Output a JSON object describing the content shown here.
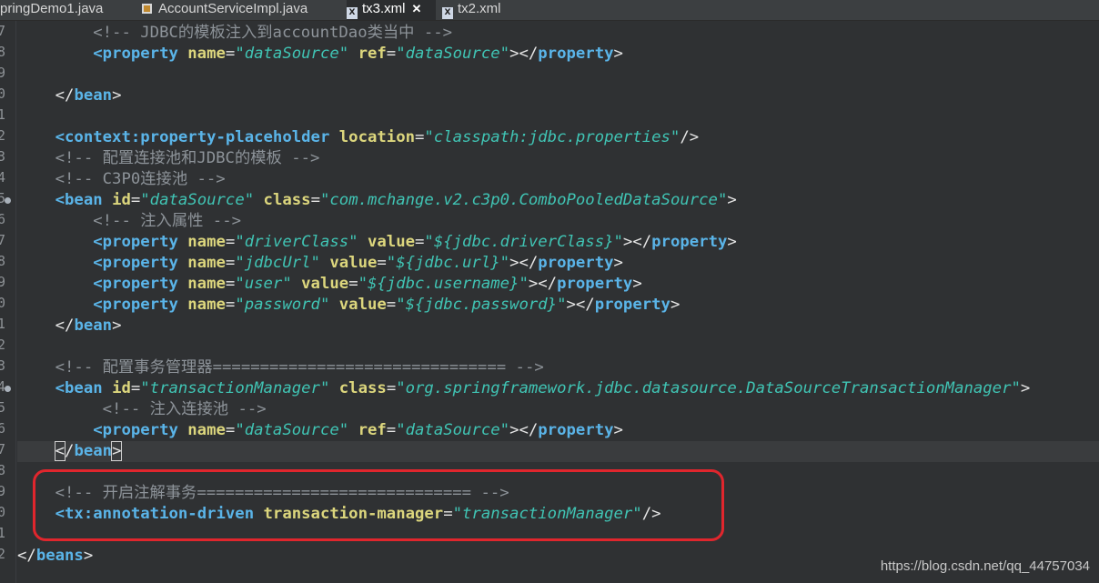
{
  "tabs": [
    {
      "label": "pringDemo1.java",
      "icon": "java-file-icon"
    },
    {
      "label": "AccountServiceImpl.java",
      "icon": "java-file-icon"
    },
    {
      "label": "tx3.xml",
      "icon": "xml-file-icon",
      "active": true,
      "close": "✕"
    },
    {
      "label": "tx2.xml",
      "icon": "xml-file-icon"
    }
  ],
  "line_numbers": [
    "7",
    "8",
    "9",
    "0",
    "1",
    "2",
    "3",
    "4",
    "5",
    "6",
    "7",
    "8",
    "9",
    "0",
    "1",
    "2",
    "3",
    "4",
    "5",
    "6",
    "7",
    "8",
    "9",
    "0",
    "1",
    "2"
  ],
  "code": [
    [
      {
        "t": "cmt",
        "s": "        <!-- JDBC的模板注入到accountDao类当中 -->"
      }
    ],
    [
      {
        "t": "ws",
        "s": "        "
      },
      {
        "t": "tag",
        "s": "<property"
      },
      {
        "t": "ws",
        "s": " "
      },
      {
        "t": "attr",
        "s": "name"
      },
      {
        "t": "eq",
        "s": "="
      },
      {
        "t": "val",
        "s": "\"dataSource\""
      },
      {
        "t": "ws",
        "s": " "
      },
      {
        "t": "attr",
        "s": "ref"
      },
      {
        "t": "eq",
        "s": "="
      },
      {
        "t": "val",
        "s": "\"dataSource\""
      },
      {
        "t": "punct",
        "s": "></"
      },
      {
        "t": "tag",
        "s": "property"
      },
      {
        "t": "punct",
        "s": ">"
      }
    ],
    [],
    [
      {
        "t": "ws",
        "s": "    "
      },
      {
        "t": "punct",
        "s": "</"
      },
      {
        "t": "tag",
        "s": "bean"
      },
      {
        "t": "punct",
        "s": ">"
      }
    ],
    [],
    [
      {
        "t": "ws",
        "s": "    "
      },
      {
        "t": "tag",
        "s": "<context:property-placeholder"
      },
      {
        "t": "ws",
        "s": " "
      },
      {
        "t": "attr",
        "s": "location"
      },
      {
        "t": "eq",
        "s": "="
      },
      {
        "t": "val",
        "s": "\"classpath:jdbc.properties\""
      },
      {
        "t": "punct",
        "s": "/>"
      }
    ],
    [
      {
        "t": "cmt",
        "s": "    <!-- 配置连接池和JDBC的模板 -->"
      }
    ],
    [
      {
        "t": "cmt",
        "s": "    <!-- C3P0连接池 -->"
      }
    ],
    [
      {
        "t": "ws",
        "s": "    "
      },
      {
        "t": "tag",
        "s": "<bean"
      },
      {
        "t": "ws",
        "s": " "
      },
      {
        "t": "attr",
        "s": "id"
      },
      {
        "t": "eq",
        "s": "="
      },
      {
        "t": "val",
        "s": "\"dataSource\""
      },
      {
        "t": "ws",
        "s": " "
      },
      {
        "t": "attr",
        "s": "class"
      },
      {
        "t": "eq",
        "s": "="
      },
      {
        "t": "val",
        "s": "\"com.mchange.v2.c3p0.ComboPooledDataSource\""
      },
      {
        "t": "punct",
        "s": ">"
      }
    ],
    [
      {
        "t": "cmt",
        "s": "        <!-- 注入属性 -->"
      }
    ],
    [
      {
        "t": "ws",
        "s": "        "
      },
      {
        "t": "tag",
        "s": "<property"
      },
      {
        "t": "ws",
        "s": " "
      },
      {
        "t": "attr",
        "s": "name"
      },
      {
        "t": "eq",
        "s": "="
      },
      {
        "t": "val",
        "s": "\"driverClass\""
      },
      {
        "t": "ws",
        "s": " "
      },
      {
        "t": "attr",
        "s": "value"
      },
      {
        "t": "eq",
        "s": "="
      },
      {
        "t": "val",
        "s": "\"${jdbc.driverClass}\""
      },
      {
        "t": "punct",
        "s": "></"
      },
      {
        "t": "tag",
        "s": "property"
      },
      {
        "t": "punct",
        "s": ">"
      }
    ],
    [
      {
        "t": "ws",
        "s": "        "
      },
      {
        "t": "tag",
        "s": "<property"
      },
      {
        "t": "ws",
        "s": " "
      },
      {
        "t": "attr",
        "s": "name"
      },
      {
        "t": "eq",
        "s": "="
      },
      {
        "t": "val",
        "s": "\"jdbcUrl\""
      },
      {
        "t": "ws",
        "s": " "
      },
      {
        "t": "attr",
        "s": "value"
      },
      {
        "t": "eq",
        "s": "="
      },
      {
        "t": "val",
        "s": "\"${jdbc.url}\""
      },
      {
        "t": "punct",
        "s": "></"
      },
      {
        "t": "tag",
        "s": "property"
      },
      {
        "t": "punct",
        "s": ">"
      }
    ],
    [
      {
        "t": "ws",
        "s": "        "
      },
      {
        "t": "tag",
        "s": "<property"
      },
      {
        "t": "ws",
        "s": " "
      },
      {
        "t": "attr",
        "s": "name"
      },
      {
        "t": "eq",
        "s": "="
      },
      {
        "t": "val",
        "s": "\"user\""
      },
      {
        "t": "ws",
        "s": " "
      },
      {
        "t": "attr",
        "s": "value"
      },
      {
        "t": "eq",
        "s": "="
      },
      {
        "t": "val",
        "s": "\"${jdbc.username}\""
      },
      {
        "t": "punct",
        "s": "></"
      },
      {
        "t": "tag",
        "s": "property"
      },
      {
        "t": "punct",
        "s": ">"
      }
    ],
    [
      {
        "t": "ws",
        "s": "        "
      },
      {
        "t": "tag",
        "s": "<property"
      },
      {
        "t": "ws",
        "s": " "
      },
      {
        "t": "attr",
        "s": "name"
      },
      {
        "t": "eq",
        "s": "="
      },
      {
        "t": "val",
        "s": "\"password\""
      },
      {
        "t": "ws",
        "s": " "
      },
      {
        "t": "attr",
        "s": "value"
      },
      {
        "t": "eq",
        "s": "="
      },
      {
        "t": "val",
        "s": "\"${jdbc.password}\""
      },
      {
        "t": "punct",
        "s": "></"
      },
      {
        "t": "tag",
        "s": "property"
      },
      {
        "t": "punct",
        "s": ">"
      }
    ],
    [
      {
        "t": "ws",
        "s": "    "
      },
      {
        "t": "punct",
        "s": "</"
      },
      {
        "t": "tag",
        "s": "bean"
      },
      {
        "t": "punct",
        "s": ">"
      }
    ],
    [],
    [
      {
        "t": "cmt",
        "s": "    <!-- 配置事务管理器=============================== -->"
      }
    ],
    [
      {
        "t": "ws",
        "s": "    "
      },
      {
        "t": "tag",
        "s": "<bean"
      },
      {
        "t": "ws",
        "s": " "
      },
      {
        "t": "attr",
        "s": "id"
      },
      {
        "t": "eq",
        "s": "="
      },
      {
        "t": "val",
        "s": "\"transactionManager\""
      },
      {
        "t": "ws",
        "s": " "
      },
      {
        "t": "attr",
        "s": "class"
      },
      {
        "t": "eq",
        "s": "="
      },
      {
        "t": "val",
        "s": "\"org.springframework.jdbc.datasource.DataSourceTransactionManager\""
      },
      {
        "t": "punct",
        "s": ">"
      }
    ],
    [
      {
        "t": "cmt",
        "s": "         <!-- 注入连接池 -->"
      }
    ],
    [
      {
        "t": "ws",
        "s": "        "
      },
      {
        "t": "tag",
        "s": "<property"
      },
      {
        "t": "ws",
        "s": " "
      },
      {
        "t": "attr",
        "s": "name"
      },
      {
        "t": "eq",
        "s": "="
      },
      {
        "t": "val",
        "s": "\"dataSource\""
      },
      {
        "t": "ws",
        "s": " "
      },
      {
        "t": "attr",
        "s": "ref"
      },
      {
        "t": "eq",
        "s": "="
      },
      {
        "t": "val",
        "s": "\"dataSource\""
      },
      {
        "t": "punct",
        "s": "></"
      },
      {
        "t": "tag",
        "s": "property"
      },
      {
        "t": "punct",
        "s": ">"
      }
    ],
    [
      {
        "t": "ws",
        "s": "    "
      },
      {
        "t": "punctbox",
        "s": "<"
      },
      {
        "t": "punct",
        "s": "/"
      },
      {
        "t": "tag",
        "s": "bean"
      },
      {
        "t": "punctbox",
        "s": ">"
      }
    ],
    [],
    [
      {
        "t": "cmt",
        "s": "    <!-- 开启注解事务============================= -->"
      }
    ],
    [
      {
        "t": "ws",
        "s": "    "
      },
      {
        "t": "tag",
        "s": "<tx:annotation-driven"
      },
      {
        "t": "ws",
        "s": " "
      },
      {
        "t": "attr",
        "s": "transaction-manager"
      },
      {
        "t": "eq",
        "s": "="
      },
      {
        "t": "val",
        "s": "\"transactionManager\""
      },
      {
        "t": "punct",
        "s": "/>"
      }
    ],
    [],
    [
      {
        "t": "punct",
        "s": "</"
      },
      {
        "t": "tag",
        "s": "beans"
      },
      {
        "t": "punct",
        "s": ">"
      }
    ]
  ],
  "current_line_index": 20,
  "fold_marker_lines": [
    8,
    17
  ],
  "watermark": "https://blog.csdn.net/qq_44757034"
}
